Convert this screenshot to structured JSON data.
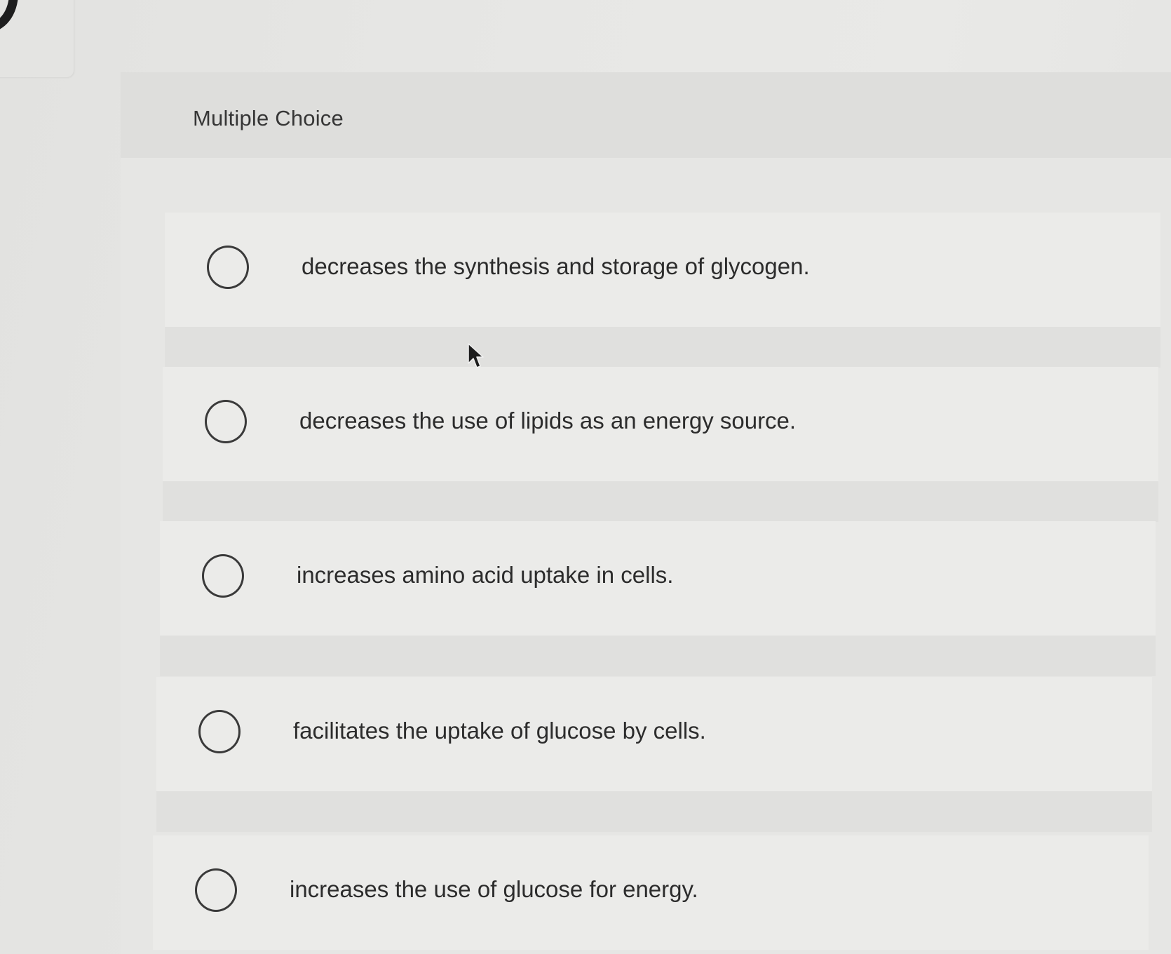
{
  "question": {
    "type_label": "Multiple Choice",
    "options": [
      {
        "label": "decreases the synthesis and storage of glycogen."
      },
      {
        "label": "decreases the use of lipids as an energy source."
      },
      {
        "label": "increases amino acid uptake in cells."
      },
      {
        "label": "facilitates the uptake of glucose by cells."
      },
      {
        "label": "increases the use of glucose for energy."
      }
    ]
  }
}
